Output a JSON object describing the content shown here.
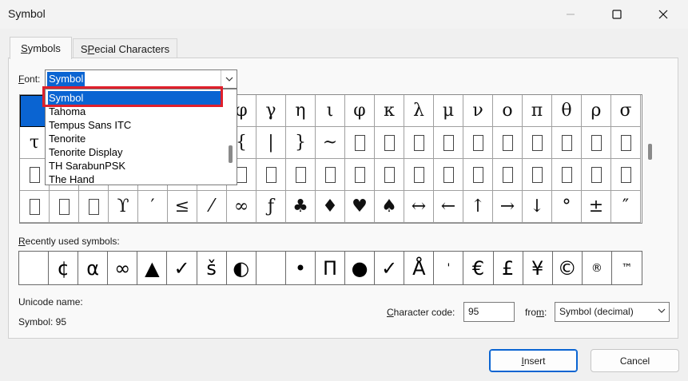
{
  "window": {
    "title": "Symbol"
  },
  "tabs": [
    {
      "label_pre": "S",
      "label_rest": "ymbols",
      "active": true
    },
    {
      "label_pre": "",
      "label_ak": "P",
      "label_rest": "ecial Characters",
      "label_start": "S"
    }
  ],
  "font": {
    "label_ak": "F",
    "label_rest": "ont:",
    "value": "Symbol"
  },
  "dropdown": {
    "items": [
      "Symbol",
      "Tahoma",
      "Tempus Sans ITC",
      "Tenorite",
      "Tenorite Display",
      "TH SarabunPSK",
      "The Hand"
    ],
    "selected_index": 0
  },
  "symbol_grid": {
    "rows": [
      [
        "",
        "",
        "",
        "",
        "",
        "",
        "",
        "φ",
        "γ",
        "η",
        "ι",
        "φ",
        "κ",
        "λ",
        "μ",
        "ν",
        "ο",
        "π",
        "θ",
        "ρ",
        "σ"
      ],
      [
        "τ",
        "",
        "",
        "",
        "",
        "",
        "",
        "{",
        "|",
        "}",
        "~",
        "□",
        "□",
        "□",
        "□",
        "□",
        "□",
        "□",
        "□",
        "□",
        "□"
      ],
      [
        "□",
        "",
        "",
        "",
        "",
        "",
        "",
        "□",
        "□",
        "□",
        "□",
        "□",
        "□",
        "□",
        "□",
        "□",
        "□",
        "□",
        "□",
        "□",
        "□"
      ],
      [
        "□",
        "□",
        "□",
        "ϒ",
        "′",
        "≤",
        "⁄",
        "∞",
        "ƒ",
        "♣",
        "♦",
        "♥",
        "♠",
        "↔",
        "←",
        "↑",
        "→",
        "↓",
        "°",
        "±",
        "″"
      ]
    ]
  },
  "recent": {
    "label_ak": "R",
    "label_rest": "ecently used symbols:",
    "symbols": [
      "",
      "¢",
      "α",
      "∞",
      "▲",
      "✓",
      "š",
      "◐",
      "",
      "•",
      "Π",
      "●",
      "✓",
      "Å",
      "'",
      "€",
      "£",
      "¥",
      "©",
      "®",
      "™"
    ]
  },
  "unicode": {
    "label": "Unicode name:",
    "value": "Symbol: 95"
  },
  "character_code": {
    "label_ak": "C",
    "label_rest": "haracter code:",
    "value": "95"
  },
  "from": {
    "label_pre": "fro",
    "label_ak": "m",
    "label_rest": ":",
    "value": "Symbol (decimal)"
  },
  "buttons": {
    "insert_ak": "I",
    "insert_rest": "nsert",
    "cancel": "Cancel"
  },
  "colors": {
    "accent": "#0a64d2",
    "highlight_box": "#e0202c"
  }
}
